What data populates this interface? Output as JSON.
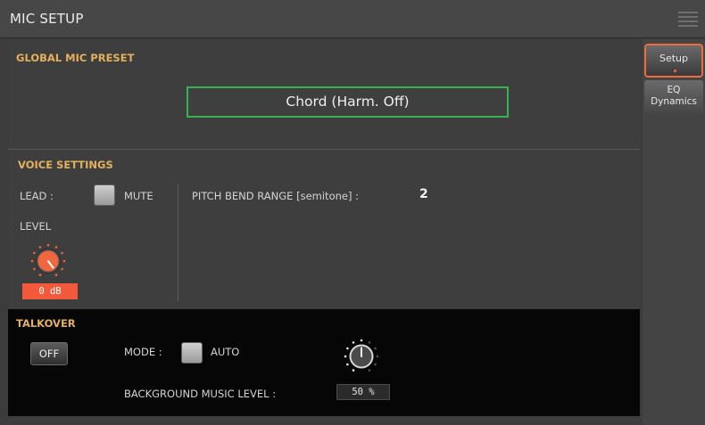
{
  "window": {
    "title": "MIC SETUP",
    "menu_icon": "hamburger-menu-icon"
  },
  "global_preset": {
    "heading": "GLOBAL MIC PRESET",
    "value": "Chord (Harm. Off)"
  },
  "voice": {
    "heading": "VOICE SETTINGS",
    "lead_label": "LEAD :",
    "mute_label": "MUTE",
    "mute_checked": false,
    "level_label": "LEVEL",
    "level_value": "0 dB",
    "pitch_bend_label": "PITCH BEND RANGE [semitone] :",
    "pitch_bend_value": "2"
  },
  "talkover": {
    "heading": "TALKOVER",
    "off_label": "OFF",
    "mode_label": "MODE :",
    "auto_label": "AUTO",
    "auto_checked": false,
    "bg_level_label": "BACKGROUND MUSIC LEVEL :",
    "bg_level_value": "50 %"
  },
  "tabs": [
    {
      "label": "Setup",
      "active": true
    },
    {
      "label_line1": "EQ",
      "label_line2": "Dynamics",
      "active": false
    }
  ],
  "colors": {
    "accent_orange": "#ef6b3e",
    "section_heading": "#e3b05d",
    "preset_border": "#39b34f",
    "level_readout": "#f25a3b"
  }
}
